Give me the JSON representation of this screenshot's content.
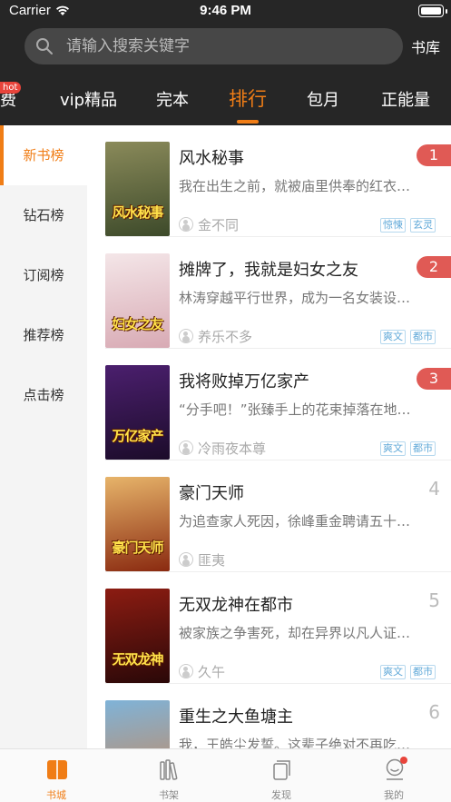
{
  "status_bar": {
    "carrier": "Carrier",
    "time": "9:46 PM"
  },
  "search": {
    "placeholder": "请输入搜索关键字"
  },
  "header": {
    "library_label": "书库"
  },
  "tabs": [
    {
      "label": "费",
      "badge": "hot"
    },
    {
      "label": "vip精品"
    },
    {
      "label": "完本"
    },
    {
      "label": "排行",
      "active": true
    },
    {
      "label": "包月"
    },
    {
      "label": "正能量"
    }
  ],
  "sidebar": {
    "items": [
      {
        "label": "新书榜",
        "active": true
      },
      {
        "label": "钻石榜"
      },
      {
        "label": "订阅榜"
      },
      {
        "label": "推荐榜"
      },
      {
        "label": "点击榜"
      }
    ]
  },
  "books": [
    {
      "rank": "1",
      "title": "风水秘事",
      "desc": "我在出生之前，就被庙里供奉的红衣…",
      "author": "金不同",
      "tags": [
        "惊悚",
        "玄灵"
      ],
      "cover_text": "风水秘事",
      "cover_colors": [
        "#8a8a5a",
        "#3d4a2a"
      ]
    },
    {
      "rank": "2",
      "title": "摊牌了，我就是妇女之友",
      "desc": "林涛穿越平行世界，成为一名女装设…",
      "author": "养乐不多",
      "tags": [
        "爽文",
        "都市"
      ],
      "cover_text": "妇女之友",
      "cover_colors": [
        "#f4e6e8",
        "#d8aab4"
      ]
    },
    {
      "rank": "3",
      "title": "我将败掉万亿家产",
      "desc": "“分手吧！”张臻手上的花束掉落在地…",
      "author": "冷雨夜本尊",
      "tags": [
        "爽文",
        "都市"
      ],
      "cover_text": "万亿家产",
      "cover_colors": [
        "#4b1f6e",
        "#1c0c2a"
      ]
    },
    {
      "rank": "4",
      "title": "豪门天师",
      "desc": "为追查家人死因，徐峰重金聘请五十…",
      "author": "匪夷",
      "tags": [],
      "cover_text": "豪门天师",
      "cover_colors": [
        "#e7b46a",
        "#8a2a10"
      ]
    },
    {
      "rank": "5",
      "title": "无双龙神在都市",
      "desc": "被家族之争害死，却在异界以凡人证…",
      "author": "久午",
      "tags": [
        "爽文",
        "都市"
      ],
      "cover_text": "无双龙神",
      "cover_colors": [
        "#8c1c12",
        "#2a0808"
      ]
    },
    {
      "rank": "6",
      "title": "重生之大鱼塘主",
      "desc": "我，王皓尘发誓。这辈子绝对不再吃…",
      "author": "",
      "tags": [],
      "cover_text": "",
      "cover_colors": [
        "#7fb3d8",
        "#c8875a"
      ]
    }
  ],
  "tabbar": {
    "items": [
      {
        "label": "书城",
        "icon": "book-icon",
        "active": true
      },
      {
        "label": "书架",
        "icon": "bookshelf-icon"
      },
      {
        "label": "发现",
        "icon": "discover-icon"
      },
      {
        "label": "我的",
        "icon": "profile-icon"
      }
    ]
  },
  "colors": {
    "accent": "#f07d16",
    "header_bg": "#262626",
    "rank_badge": "#e05a55",
    "tag": "#5fa8d8"
  }
}
